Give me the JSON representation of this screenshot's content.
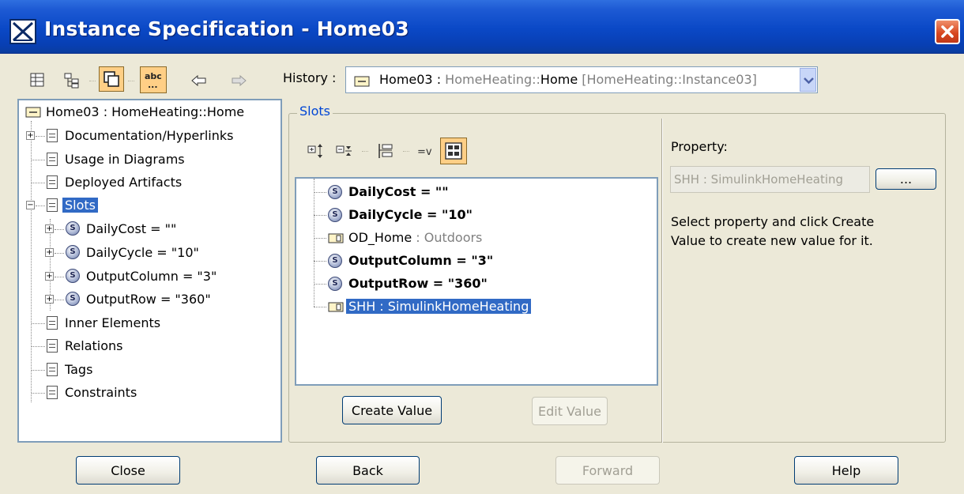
{
  "window": {
    "title": "Instance Specification - Home03"
  },
  "toolbar": {
    "history_label": "History :",
    "history_value": {
      "name": "Home03",
      "separator": " : ",
      "type_prefix": "HomeHeating::",
      "type_name": "Home",
      "scope": " [HomeHeating::Instance03]"
    }
  },
  "tree": {
    "root": "Home03 : HomeHeating::Home",
    "items": [
      {
        "label": "Documentation/Hyperlinks"
      },
      {
        "label": "Usage in Diagrams"
      },
      {
        "label": "Deployed Artifacts"
      },
      {
        "label": "Slots"
      },
      {
        "label": "DailyCost = \"\""
      },
      {
        "label": "DailyCycle = \"10\""
      },
      {
        "label": "OutputColumn = \"3\""
      },
      {
        "label": "OutputRow = \"360\""
      },
      {
        "label": "Inner Elements"
      },
      {
        "label": "Relations"
      },
      {
        "label": "Tags"
      },
      {
        "label": "Constraints"
      }
    ]
  },
  "slots": {
    "group_title": "Slots",
    "items": [
      {
        "label": "DailyCost = \"\""
      },
      {
        "label": "DailyCycle = \"10\""
      },
      {
        "name": "OD_Home",
        "type": " : Outdoors"
      },
      {
        "label": "OutputColumn = \"3\""
      },
      {
        "label": "OutputRow = \"360\""
      },
      {
        "label": "SHH : SimulinkHomeHeating"
      }
    ],
    "create_value": "Create Value",
    "edit_value": "Edit Value"
  },
  "property": {
    "label": "Property:",
    "value": "SHH : SimulinkHomeHeating",
    "browse": "...",
    "hint_line1": "Select property and click Create",
    "hint_line2": "Value to create new value for it."
  },
  "buttons": {
    "close": "Close",
    "back": "Back",
    "forward": "Forward",
    "help": "Help"
  },
  "icons": {
    "app": "dialog-app-icon",
    "close": "close-icon",
    "toolbar": [
      "table-view-icon",
      "tree-view-icon",
      "compact-mode-icon",
      "text-mode-icon",
      "back-arrow-icon",
      "forward-arrow-icon"
    ],
    "slots_toolbar": [
      "expand-all-icon",
      "collapse-all-icon",
      "group-icon",
      "show-values-icon",
      "layout-icon"
    ]
  },
  "colors": {
    "title_bar": "#0a48c6",
    "selection": "#316ac5",
    "accent_toggle": "#ffcf86",
    "close_red": "#d7451d"
  }
}
